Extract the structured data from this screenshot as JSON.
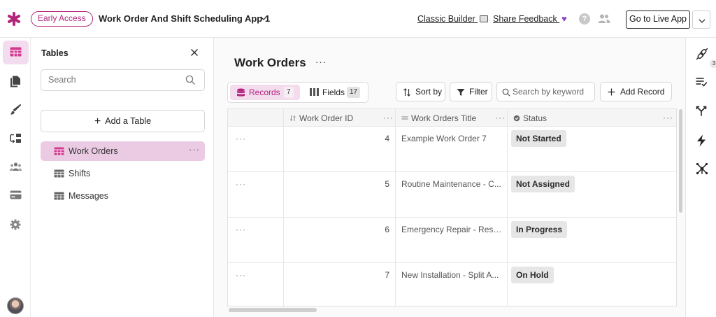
{
  "header": {
    "badge": "Early Access",
    "app_title": "Work Order And Shift Scheduling App 1",
    "classic_builder": "Classic Builder",
    "share_feedback": "Share Feedback",
    "help_glyph": "?",
    "live_button": "Go to Live App",
    "brand_color": "#b2257c"
  },
  "left_rail": {
    "icons": [
      "tables-icon",
      "pages-icon",
      "brush-icon",
      "automation-icon",
      "users-icon",
      "payments-icon",
      "settings-icon"
    ]
  },
  "tables_panel": {
    "title": "Tables",
    "search_placeholder": "Search",
    "add_table": "Add a Table",
    "tables": [
      {
        "label": "Work Orders",
        "active": true
      },
      {
        "label": "Shifts",
        "active": false
      },
      {
        "label": "Messages",
        "active": false
      }
    ],
    "more_glyph": "···"
  },
  "main": {
    "title": "Work Orders",
    "more_glyph": "···",
    "tabs": {
      "records_label": "Records",
      "records_count": "7",
      "fields_label": "Fields",
      "fields_count": "17"
    },
    "sort_label": "Sort by",
    "filter_label": "Filter",
    "keyword_placeholder": "Search by keyword",
    "add_record": "Add Record",
    "columns": {
      "id": "Work Order ID",
      "title": "Work Orders Title",
      "status": "Status"
    },
    "rows": [
      {
        "id": "4",
        "title": "Example Work Order 7",
        "status": "Not Started"
      },
      {
        "id": "5",
        "title": "Routine Maintenance - C...",
        "status": "Not Assigned"
      },
      {
        "id": "6",
        "title": "Emergency Repair - Resi...",
        "status": "In Progress"
      },
      {
        "id": "7",
        "title": "New Installation - Split A...",
        "status": "On Hold"
      }
    ]
  },
  "right_rail": {
    "icons": [
      "plug-icon",
      "list-check-icon",
      "branch-icon",
      "bolt-icon",
      "network-icon"
    ],
    "plug_count": "3"
  }
}
